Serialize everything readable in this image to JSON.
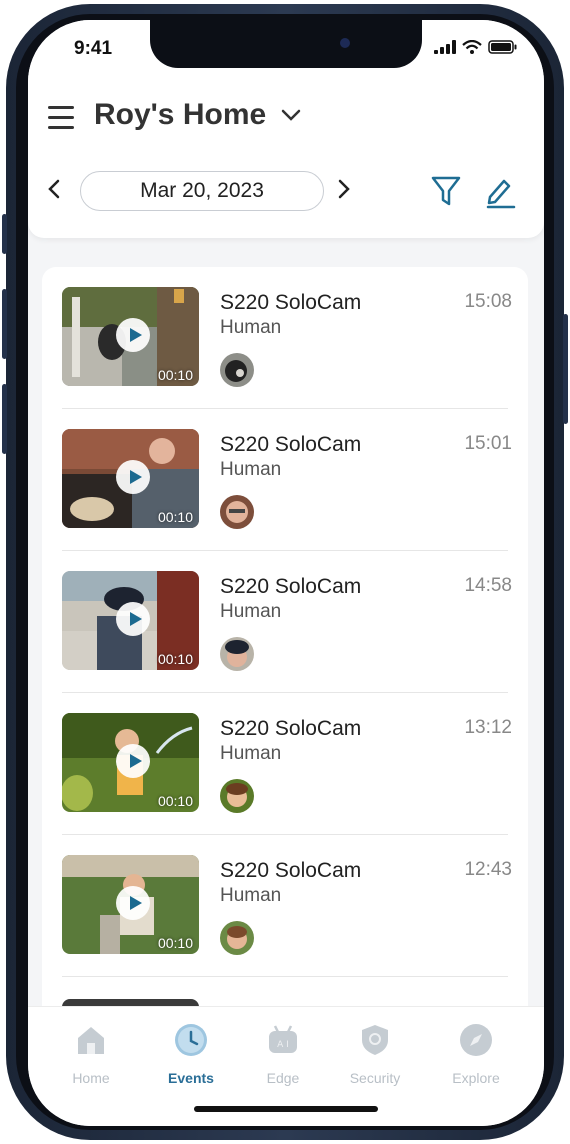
{
  "status_bar": {
    "time": "9:41"
  },
  "header": {
    "home_name": "Roy's Home",
    "date": "Mar 20, 2023"
  },
  "events": [
    {
      "camera": "S220 SoloCam",
      "type": "Human",
      "time": "15:08",
      "duration": "00:10"
    },
    {
      "camera": "S220 SoloCam",
      "type": "Human",
      "time": "15:01",
      "duration": "00:10"
    },
    {
      "camera": "S220 SoloCam",
      "type": "Human",
      "time": "14:58",
      "duration": "00:10"
    },
    {
      "camera": "S220 SoloCam",
      "type": "Human",
      "time": "13:12",
      "duration": "00:10"
    },
    {
      "camera": "S220 SoloCam",
      "type": "Human",
      "time": "12:43",
      "duration": "00:10"
    }
  ],
  "tabs": [
    {
      "label": "Home",
      "icon": "home-icon",
      "active": false
    },
    {
      "label": "Events",
      "icon": "clock-icon",
      "active": true
    },
    {
      "label": "Edge",
      "icon": "ai-robot-icon",
      "active": false
    },
    {
      "label": "Security",
      "icon": "shield-icon",
      "active": false
    },
    {
      "label": "Explore",
      "icon": "compass-icon",
      "active": false
    }
  ],
  "colors": {
    "accent": "#2a6e97",
    "inactive": "#b8bfc6",
    "frame": "#1b2536"
  }
}
